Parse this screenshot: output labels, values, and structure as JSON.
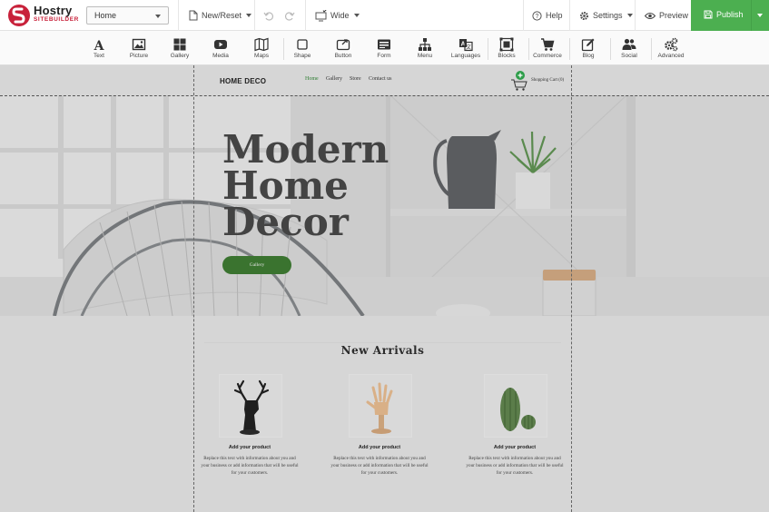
{
  "app": {
    "logo_name": "Hostry",
    "logo_sub": "SITEBUILDER"
  },
  "toolbar": {
    "page_select_value": "Home",
    "new_reset_label": "New/Reset",
    "view_mode_label": "Wide",
    "help_label": "Help",
    "settings_label": "Settings",
    "preview_label": "Preview",
    "publish_label": "Publish",
    "publish_color": "#4caf50"
  },
  "widgets": [
    {
      "label": "Text",
      "icon": "text-icon"
    },
    {
      "label": "Picture",
      "icon": "picture-icon"
    },
    {
      "label": "Gallery",
      "icon": "gallery-icon"
    },
    {
      "label": "Media",
      "icon": "media-icon"
    },
    {
      "label": "Maps",
      "icon": "maps-icon"
    },
    {
      "label": "Shape",
      "icon": "shape-icon"
    },
    {
      "label": "Button",
      "icon": "button-icon"
    },
    {
      "label": "Form",
      "icon": "form-icon"
    },
    {
      "label": "Menu",
      "icon": "menu-icon"
    },
    {
      "label": "Languages",
      "icon": "languages-icon"
    },
    {
      "label": "Blocks",
      "icon": "blocks-icon"
    },
    {
      "label": "Commerce",
      "icon": "commerce-icon"
    },
    {
      "label": "Blog",
      "icon": "blog-icon"
    },
    {
      "label": "Social",
      "icon": "social-icon"
    },
    {
      "label": "Advanced",
      "icon": "advanced-icon"
    }
  ],
  "site": {
    "brand": "HOME DECO",
    "nav": [
      "Home",
      "Gallery",
      "Store",
      "Contact us"
    ],
    "active_nav": "Home",
    "cart_label": "Shopping Cart (0)",
    "hero": {
      "title_lines": [
        "Modern",
        "Home",
        "Decor"
      ],
      "button_label": "Gallery",
      "button_color": "#1f6b10"
    },
    "arrivals_title": "New Arrivals",
    "products": [
      {
        "name": "Add your product",
        "description": "Replace this text with information about you and your business or add information that will be useful for your customers.",
        "image": "deer-head-figurine"
      },
      {
        "name": "Add your product",
        "description": "Replace this text with information about you and your business or add information that will be useful for your customers.",
        "image": "wooden-hand-figurine"
      },
      {
        "name": "Add your product",
        "description": "Replace this text with information about you and your business or add information that will be useful for your customers.",
        "image": "cactus-figurines"
      }
    ]
  }
}
